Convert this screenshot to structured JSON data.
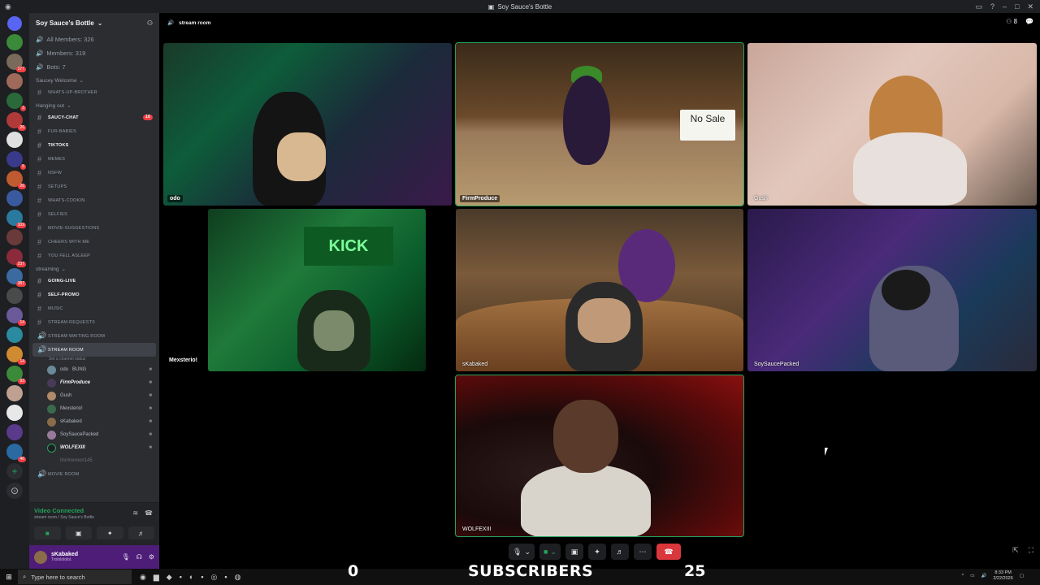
{
  "window": {
    "title": "Soy Sauce's Bottle"
  },
  "server": {
    "name": "Soy Sauce's Bottle",
    "stats": [
      {
        "label": "All Members: 326"
      },
      {
        "label": "Members: 319"
      },
      {
        "label": "Bots: 7"
      }
    ]
  },
  "categories": {
    "welcome": "Saucey Welcome",
    "hanging": "Hanging out",
    "streaming": "streaming"
  },
  "channels_welcome": [
    {
      "label": "whats-up-brother"
    }
  ],
  "channels_hanging": [
    {
      "label": "saucy-chat",
      "mention": "16"
    },
    {
      "label": "fur-babies"
    },
    {
      "label": "tiktoks"
    },
    {
      "label": "memes"
    },
    {
      "label": "nsfw"
    },
    {
      "label": "setups"
    },
    {
      "label": "whats-cookin"
    },
    {
      "label": "selfies"
    },
    {
      "label": "movie-suggestions"
    },
    {
      "label": "cheers with me"
    },
    {
      "label": "you fell asleep"
    }
  ],
  "channels_streaming": [
    {
      "label": "going-live"
    },
    {
      "label": "self-promo"
    },
    {
      "label": "music"
    },
    {
      "label": "stream-requests"
    },
    {
      "label": "stream waiting room"
    }
  ],
  "active_channel": {
    "label": "stream room",
    "status": "Set a channel status"
  },
  "voice_users": [
    {
      "name": "odo",
      "extra": "BUNG",
      "color": "#6a8a9a"
    },
    {
      "name": "FirmProduce",
      "color": "#4a3a5a"
    },
    {
      "name": "Gush",
      "color": "#b08a6a"
    },
    {
      "name": "Mexsterio!",
      "color": "#3a6a4a"
    },
    {
      "name": "sKabaked",
      "color": "#8a6b4a"
    },
    {
      "name": "SoySaucePacked",
      "color": "#9a7a9a"
    },
    {
      "name": "WOLFEXIII",
      "color": "#1e1f22"
    },
    {
      "name": "itsrimeroon145",
      "color": "#2b2d31"
    }
  ],
  "movie_room": {
    "label": "movie room"
  },
  "voice_panel": {
    "status": "Video Connected",
    "sub": "stream room / Soy Sauce's Bottle",
    "buttons": [
      "camera-icon",
      "screen-share-icon",
      "activities-icon",
      "soundboard-icon"
    ]
  },
  "user": {
    "name": "sKabaked",
    "status": "Trololololol."
  },
  "stage_header": {
    "channel": "stream room",
    "member_count": "8"
  },
  "tiles": [
    {
      "name": "odo"
    },
    {
      "name": "FirmProduce",
      "sign": "No Sale"
    },
    {
      "name": "Gush"
    },
    {
      "name": "Mexsterio!",
      "sign": "KICK"
    },
    {
      "name": "sKabaked"
    },
    {
      "name": "SoySaucePacked"
    },
    {
      "name": "WOLFEXIII"
    }
  ],
  "overlay": {
    "left_number": "0",
    "text": "SUBSCRIBERS",
    "right_number": "25"
  },
  "taskbar": {
    "search_placeholder": "Type here to search",
    "time": "8:33 PM",
    "date": "2/22/2026"
  },
  "colors": {
    "accent": "#23a55a",
    "mention": "#f23f43",
    "hangup": "#da373c",
    "user_panel": "#4e1d78"
  }
}
